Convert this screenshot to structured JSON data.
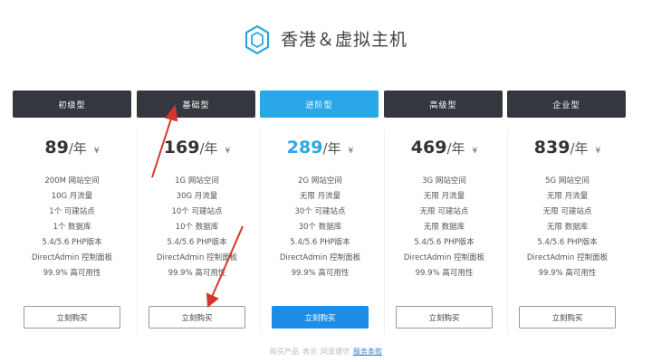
{
  "header": {
    "title": "香港＆虚拟主机",
    "icon": "hexagon-logo-icon"
  },
  "colors": {
    "dark_tab": "#34383e",
    "accent": "#2aa7e6",
    "buy_featured": "#1f8de6",
    "arrow": "#d9342b"
  },
  "plans": [
    {
      "name": "初级型",
      "price": "89",
      "unit": "/年",
      "currency": "¥",
      "features": [
        "200M 网站空间",
        "10G 月流量",
        "1个 可建站点",
        "1个 数据库",
        "5.4/5.6 PHP版本",
        "DirectAdmin 控制面板",
        "99.9% 高可用性"
      ],
      "buy_label": "立刻购买"
    },
    {
      "name": "基础型",
      "price": "169",
      "unit": "/年",
      "currency": "¥",
      "features": [
        "1G 网站空间",
        "30G 月流量",
        "10个 可建站点",
        "10个 数据库",
        "5.4/5.6 PHP版本",
        "DirectAdmin 控制面板",
        "99.9% 高可用性"
      ],
      "buy_label": "立刻购买"
    },
    {
      "name": "进阶型",
      "price": "289",
      "unit": "/年",
      "currency": "¥",
      "features": [
        "2G 网站空间",
        "无限 月流量",
        "30个 可建站点",
        "30个 数据库",
        "5.4/5.6 PHP版本",
        "DirectAdmin 控制面板",
        "99.9% 高可用性"
      ],
      "buy_label": "立刻购买"
    },
    {
      "name": "高级型",
      "price": "469",
      "unit": "/年",
      "currency": "¥",
      "features": [
        "3G 网站空间",
        "无限 月流量",
        "无限 可建站点",
        "无限 数据库",
        "5.4/5.6 PHP版本",
        "DirectAdmin 控制面板",
        "99.9% 高可用性"
      ],
      "buy_label": "立刻购买"
    },
    {
      "name": "企业型",
      "price": "839",
      "unit": "/年",
      "currency": "¥",
      "features": [
        "5G 网站空间",
        "无限 月流量",
        "无限 可建站点",
        "无限 数据库",
        "5.4/5.6 PHP版本",
        "DirectAdmin 控制面板",
        "99.9% 高可用性"
      ],
      "buy_label": "立刻购买"
    }
  ],
  "footer": {
    "text1": "购买产品",
    "text2": "表示",
    "text3": "同意遵守",
    "link": "服务条款"
  }
}
